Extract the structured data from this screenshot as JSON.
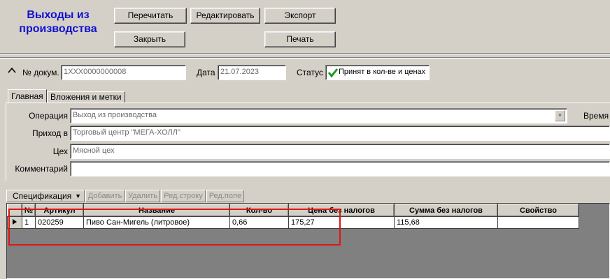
{
  "header": {
    "title": "Выходы из производства"
  },
  "toolbar": {
    "reread": "Перечитать",
    "edit": "Редактировать",
    "export": "Экспорт",
    "close": "Закрыть",
    "print": "Печать"
  },
  "doc": {
    "collapse_icon": "chevron-up-icon",
    "number_label": "№ докум.",
    "number_value": "1XXX0000000008",
    "date_label": "Дата",
    "date_value": "21.07.2023",
    "status_label": "Статус",
    "status_value": "Принят в кол-ве и ценах",
    "status_icon": "checkmark-icon"
  },
  "tabs": [
    {
      "label": "Главная",
      "active": true
    },
    {
      "label": "Вложения и метки",
      "active": false
    }
  ],
  "form": {
    "operation_label": "Операция",
    "operation_value": "Выход из производства",
    "time_label": "Время и",
    "income_label": "Приход в",
    "income_value": "Торговый центр \"МЕГА-ХОЛЛ\"",
    "shop_label": "Цех",
    "shop_value": "Мясной цех",
    "comment_label": "Комментарий",
    "comment_value": ""
  },
  "spec_toolbar": {
    "spec": "Спецификация",
    "add": "Добавить",
    "delete": "Удалить",
    "edit_row": "Ред.строку",
    "edit_field": "Ред.поле"
  },
  "table": {
    "columns": [
      "№",
      "Артикул",
      "Название",
      "Кол-во",
      "Цена без налогов",
      "Сумма без налогов",
      "Свойство"
    ],
    "rows": [
      {
        "num": "1",
        "article": "020259",
        "name": "Пиво Сан-Мигель (литровое)",
        "qty": "0,66",
        "price": "175,27",
        "sum": "115,68",
        "property": ""
      }
    ]
  },
  "colors": {
    "title": "#1010d0",
    "highlight_box": "#e01515",
    "status_check": "#1a9a1a"
  }
}
